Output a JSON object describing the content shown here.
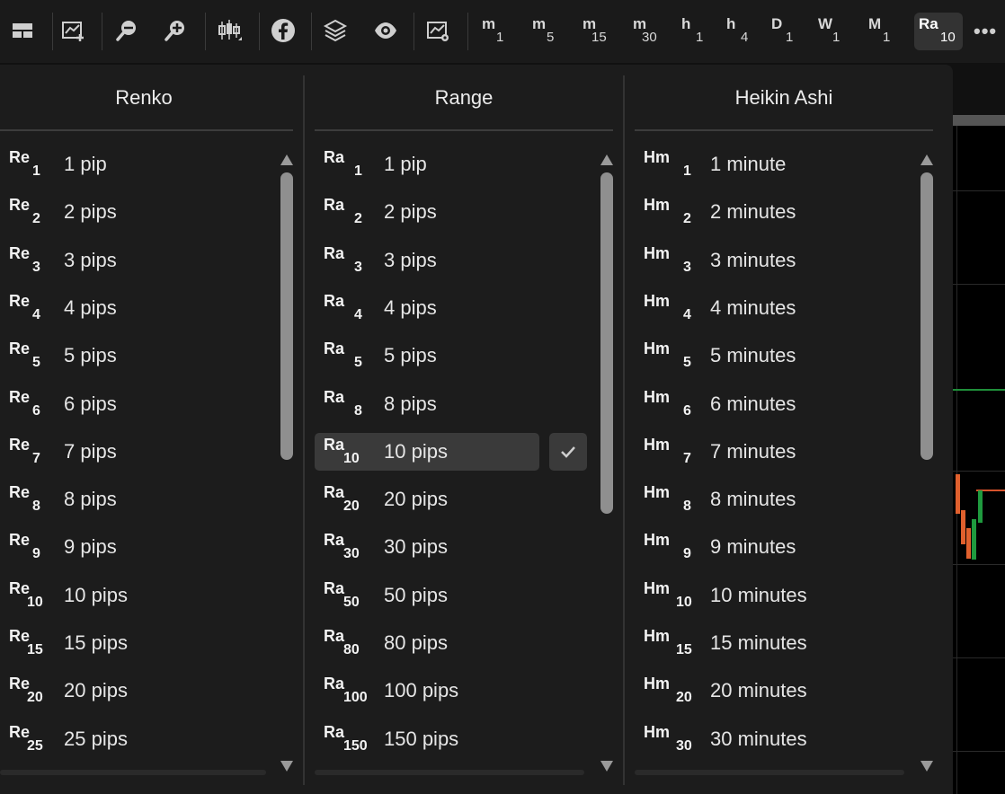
{
  "toolbar": {
    "icons": [
      "layout-icon",
      "add-chart-icon",
      "zoom-out-icon",
      "zoom-in-icon",
      "chart-type-icon",
      "facebook-icon",
      "layers-icon",
      "eye-icon",
      "chart-settings-icon"
    ],
    "timeframes": [
      {
        "main": "m",
        "sub": "1"
      },
      {
        "main": "m",
        "sub": "5"
      },
      {
        "main": "m",
        "sub": "15"
      },
      {
        "main": "m",
        "sub": "30"
      },
      {
        "main": "h",
        "sub": "1"
      },
      {
        "main": "h",
        "sub": "4"
      },
      {
        "main": "D",
        "sub": "1"
      },
      {
        "main": "W",
        "sub": "1"
      },
      {
        "main": "M",
        "sub": "1"
      },
      {
        "main": "Ra",
        "sub": "10"
      }
    ],
    "more_label": "•••"
  },
  "columns": {
    "renko": {
      "title": "Renko",
      "items": [
        {
          "abbr": "Re",
          "num": "1",
          "label": "1 pip"
        },
        {
          "abbr": "Re",
          "num": "2",
          "label": "2 pips"
        },
        {
          "abbr": "Re",
          "num": "3",
          "label": "3 pips"
        },
        {
          "abbr": "Re",
          "num": "4",
          "label": "4 pips"
        },
        {
          "abbr": "Re",
          "num": "5",
          "label": "5 pips"
        },
        {
          "abbr": "Re",
          "num": "6",
          "label": "6 pips"
        },
        {
          "abbr": "Re",
          "num": "7",
          "label": "7 pips"
        },
        {
          "abbr": "Re",
          "num": "8",
          "label": "8 pips"
        },
        {
          "abbr": "Re",
          "num": "9",
          "label": "9 pips"
        },
        {
          "abbr": "Re",
          "num": "10",
          "label": "10 pips"
        },
        {
          "abbr": "Re",
          "num": "15",
          "label": "15 pips"
        },
        {
          "abbr": "Re",
          "num": "20",
          "label": "20 pips"
        },
        {
          "abbr": "Re",
          "num": "25",
          "label": "25 pips"
        }
      ]
    },
    "range": {
      "title": "Range",
      "items": [
        {
          "abbr": "Ra",
          "num": "1",
          "label": "1 pip"
        },
        {
          "abbr": "Ra",
          "num": "2",
          "label": "2 pips"
        },
        {
          "abbr": "Ra",
          "num": "3",
          "label": "3 pips"
        },
        {
          "abbr": "Ra",
          "num": "4",
          "label": "4 pips"
        },
        {
          "abbr": "Ra",
          "num": "5",
          "label": "5 pips"
        },
        {
          "abbr": "Ra",
          "num": "8",
          "label": "8 pips"
        },
        {
          "abbr": "Ra",
          "num": "10",
          "label": "10 pips"
        },
        {
          "abbr": "Ra",
          "num": "20",
          "label": "20 pips"
        },
        {
          "abbr": "Ra",
          "num": "30",
          "label": "30 pips"
        },
        {
          "abbr": "Ra",
          "num": "50",
          "label": "50 pips"
        },
        {
          "abbr": "Ra",
          "num": "80",
          "label": "80 pips"
        },
        {
          "abbr": "Ra",
          "num": "100",
          "label": "100 pips"
        },
        {
          "abbr": "Ra",
          "num": "150",
          "label": "150 pips"
        }
      ],
      "selected": "10 pips"
    },
    "heikin": {
      "title": "Heikin Ashi",
      "items": [
        {
          "abbr": "Hm",
          "num": "1",
          "label": "1 minute"
        },
        {
          "abbr": "Hm",
          "num": "2",
          "label": "2 minutes"
        },
        {
          "abbr": "Hm",
          "num": "3",
          "label": "3 minutes"
        },
        {
          "abbr": "Hm",
          "num": "4",
          "label": "4 minutes"
        },
        {
          "abbr": "Hm",
          "num": "5",
          "label": "5 minutes"
        },
        {
          "abbr": "Hm",
          "num": "6",
          "label": "6 minutes"
        },
        {
          "abbr": "Hm",
          "num": "7",
          "label": "7 minutes"
        },
        {
          "abbr": "Hm",
          "num": "8",
          "label": "8 minutes"
        },
        {
          "abbr": "Hm",
          "num": "9",
          "label": "9 minutes"
        },
        {
          "abbr": "Hm",
          "num": "10",
          "label": "10 minutes"
        },
        {
          "abbr": "Hm",
          "num": "15",
          "label": "15 minutes"
        },
        {
          "abbr": "Hm",
          "num": "20",
          "label": "20 minutes"
        },
        {
          "abbr": "Hm",
          "num": "30",
          "label": "30 minutes"
        }
      ]
    }
  },
  "colors": {
    "background": "#1c1c1c",
    "selected_row": "#3a3a3a",
    "bullish_candle": "#1f9a3e",
    "bearish_candle": "#e0602d"
  }
}
